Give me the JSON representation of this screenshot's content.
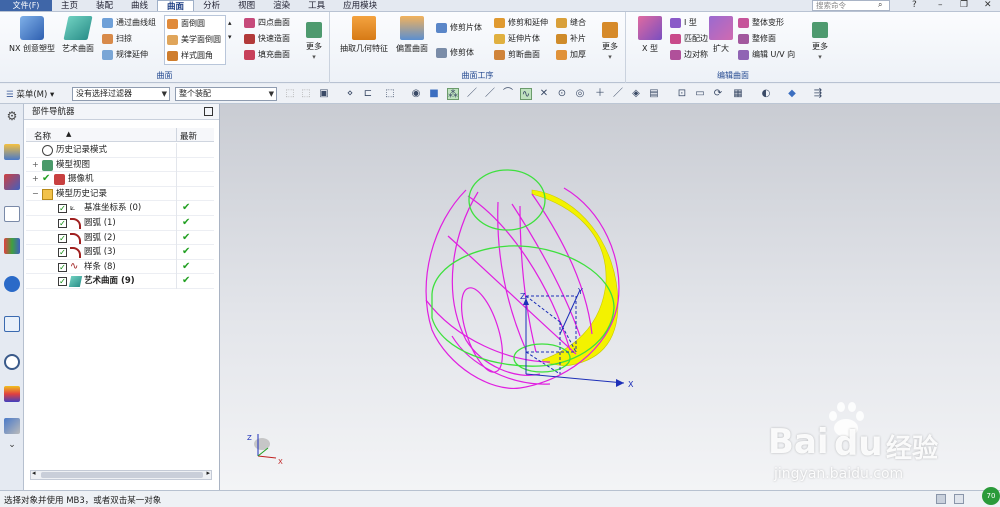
{
  "menubar": {
    "file": "文件(F)",
    "tabs": [
      "主页",
      "装配",
      "曲线",
      "曲面",
      "分析",
      "视图",
      "渲染",
      "工具",
      "应用模块"
    ],
    "active": "曲面",
    "search_placeholder": "搜索命令"
  },
  "ribbon": {
    "groups": {
      "surface": "曲面",
      "surface_ops": "曲面工序",
      "edit_surface": "编辑曲面"
    },
    "buttons": {
      "nx_creative": "NX 创意塑型",
      "art_surface": "艺术曲面",
      "through_curve_mesh": "通过曲线组",
      "sweep": "扫掠",
      "rule_extend": "规律延伸",
      "face_fillet": "面倒圆",
      "aesthetic_face_fillet": "美学面倒圆",
      "style_fillet": "样式圆角",
      "four_point_surface": "四点曲面",
      "quick_surface": "快速造面",
      "fill_surface": "填充曲面",
      "more": "更多",
      "extract_geometry": "抽取几何特征",
      "offset_surface": "偏置曲面",
      "trim_sheet": "修剪片体",
      "trim_body": "修剪体",
      "trim_extend": "修剪和延伸",
      "extend_sheet": "延伸片体",
      "delete_trim": "剪断曲面",
      "sew": "缝合",
      "patch": "补片",
      "thicken": "加厚",
      "x_type": "X 型",
      "i_type": "I 型",
      "match_edge": "匹配边",
      "edge_symmetry": "边对称",
      "enlarge": "扩大",
      "global_shape": "整体变形",
      "refit_face": "整修面",
      "edit_uv": "编辑 U/V 向"
    }
  },
  "toolbar": {
    "menu": "菜单(M)",
    "filter": "没有选择过滤器",
    "assembly": "整个装配"
  },
  "navigator": {
    "title": "部件导航器",
    "col_name": "名称",
    "col_latest": "最新",
    "rows": [
      {
        "label": "历史记录模式",
        "indent": 0
      },
      {
        "label": "模型视图",
        "indent": 0
      },
      {
        "label": "摄像机",
        "indent": 0
      },
      {
        "label": "模型历史记录",
        "indent": 0
      },
      {
        "label": "基准坐标系 (0)",
        "indent": 1,
        "latest": true
      },
      {
        "label": "圆弧 (1)",
        "indent": 1,
        "latest": true
      },
      {
        "label": "圆弧 (2)",
        "indent": 1,
        "latest": true
      },
      {
        "label": "圆弧 (3)",
        "indent": 1,
        "latest": true
      },
      {
        "label": "样条 (8)",
        "indent": 1,
        "latest": true
      },
      {
        "label": "艺术曲面 (9)",
        "indent": 1,
        "latest": true,
        "bold": true
      }
    ]
  },
  "viewport": {
    "axes": {
      "x": "X",
      "y": "Y",
      "z": "Z"
    },
    "colors": {
      "pink": "#e01fe0",
      "green": "#3ee03e",
      "yellow": "#f3f200",
      "blue": "#1d2fb8"
    }
  },
  "status": {
    "text": "选择对象并使用 MB3，或者双击某一对象",
    "badge": "70"
  },
  "watermark": {
    "brand": "Bai",
    "brand_suffix": "du",
    "site_cn": "经验",
    "url": "jingyan.baidu.com"
  }
}
